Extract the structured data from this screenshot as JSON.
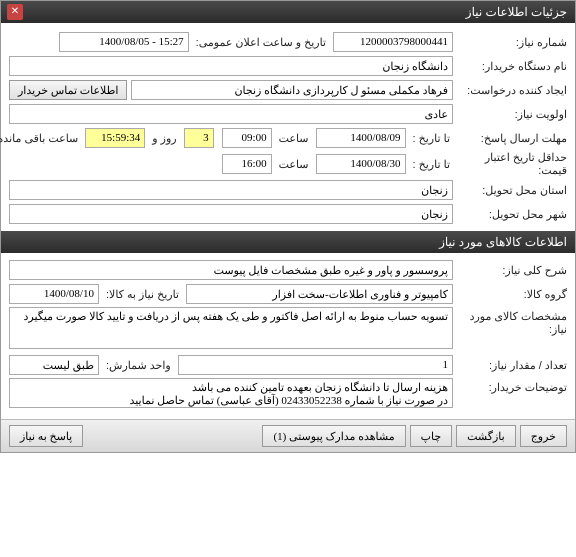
{
  "window": {
    "title": "جزئیات اطلاعات نیاز",
    "close": "✕"
  },
  "labels": {
    "need_no": "شماره نیاز:",
    "announce_datetime": "تاریخ و ساعت اعلان عمومی:",
    "buyer_org": "نام دستگاه خریدار:",
    "request_creator": "ایجاد کننده درخواست:",
    "priority": "اولویت نیاز:",
    "reply_deadline": "مهلت ارسال پاسخ:",
    "to_date": "تا تاریخ :",
    "hour": "ساعت",
    "day_and": "روز و",
    "hours_remaining": "ساعت باقی مانده",
    "min_validity": "حداقل تاریخ اعتبار قیمت:",
    "delivery_province": "استان محل تحویل:",
    "delivery_city": "شهر محل تحویل:",
    "contact_btn": "اطلاعات تماس خریدار"
  },
  "values": {
    "need_no": "1200003798000441",
    "announce_date": "1400/08/05",
    "announce_time": "15:27",
    "buyer_org": "دانشگاه زنجان",
    "request_creator": "فرهاد مکملی مسئو ل کارپردازی دانشگاه زنجان",
    "priority": "عادی",
    "reply_date": "1400/08/09",
    "reply_time": "09:00",
    "days_left": "3",
    "time_left": "15:59:34",
    "validity_date": "1400/08/30",
    "validity_time": "16:00",
    "province": "زنجان",
    "city": "زنجان"
  },
  "section2_title": "اطلاعات کالاهای مورد نیاز",
  "labels2": {
    "need_desc": "شرح کلی نیاز:",
    "goods_group": "گروه کالا:",
    "need_to_date": "تاریخ نیاز به کالا:",
    "item_spec": "مشخصات کالای مورد نیاز:",
    "qty": "تعداد / مقدار نیاز:",
    "count_unit": "واحد شمارش:",
    "buyer_notes": "توضیحات خریدار:"
  },
  "values2": {
    "need_desc": "پروسسور و پاور و غیره طبق مشخصات فایل پیوست",
    "goods_group": "کامپیوتر و فناوری اطلاعات-سخت افزار",
    "need_to_date": "1400/08/10",
    "item_spec": "تسویه حساب منوط به ارائه اصل فاکتور و طی یک هفته پس از دریافت و تایید کالا صورت میگیرد",
    "qty": "1",
    "count_unit": "طبق لیست",
    "buyer_notes": "هزینه ارسال تا دانشگاه زنجان بعهده تامین کننده می باشد\nدر صورت نیاز با شماره 02433052238 (آقای عباسی) تماس حاصل نمایید"
  },
  "footer": {
    "reply": "پاسخ به نیاز",
    "attachments": "مشاهده مدارک پیوستی (1)",
    "print": "چاپ",
    "back": "بازگشت",
    "exit": "خروج"
  }
}
